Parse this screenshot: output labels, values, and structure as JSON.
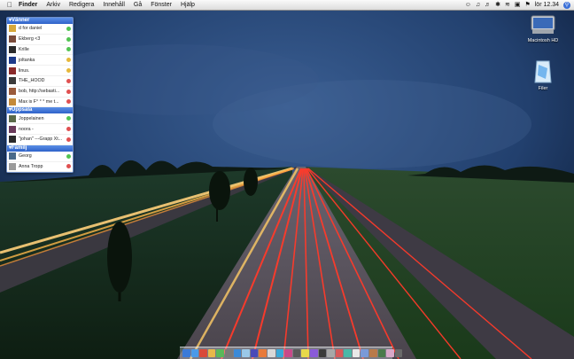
{
  "menubar": {
    "app": "Finder",
    "items": [
      "Arkiv",
      "Redigera",
      "Innehåll",
      "Gå",
      "Fönster",
      "Hjälp"
    ],
    "clock": "lör 12.34"
  },
  "buddy_list": {
    "groups": [
      {
        "name": "Vänner",
        "buddies": [
          {
            "name": "d for daniel",
            "status": "#52c452",
            "avatar": "#d7a83a"
          },
          {
            "name": "Ekberg <3",
            "status": "#52c452",
            "avatar": "#7a4b3a"
          },
          {
            "name": "Krille",
            "status": "#52c452",
            "avatar": "#2a2a2a"
          },
          {
            "name": "joltanka",
            "status": "#e6b83a",
            "avatar": "#1c3a8a"
          },
          {
            "name": "linus.",
            "status": "#e6b83a",
            "avatar": "#8a2a2a"
          },
          {
            "name": "THE_HOOD",
            "status": "#e05050",
            "avatar": "#3a3a3a"
          },
          {
            "name": "bob, http://sebasti...",
            "status": "#e05050",
            "avatar": "#9a5a3a"
          },
          {
            "name": "Max is F° ° ° me t...",
            "status": "#e05050",
            "avatar": "#c48a3a"
          }
        ]
      },
      {
        "name": "Uppsala",
        "buddies": [
          {
            "name": "Joppelainen",
            "status": "#52c452",
            "avatar": "#5a6a4a"
          },
          {
            "name": "noora -",
            "status": "#e05050",
            "avatar": "#6a3a5a"
          },
          {
            "name": "\"johan\" ---Grapp Xt...",
            "status": "#e05050",
            "avatar": "#2a2a2a"
          }
        ]
      },
      {
        "name": "Familj",
        "buddies": [
          {
            "name": "Georg",
            "status": "#52c452",
            "avatar": "#4a6a8a"
          },
          {
            "name": "Anna Tropp",
            "status": "#e05050",
            "avatar": "#9a9a9a"
          }
        ]
      }
    ]
  },
  "desktop_icons": {
    "hd": "Macintosh HD",
    "files": "Filer"
  },
  "dock": {
    "icons": [
      "#3a7ad8",
      "#4a9ae8",
      "#d84a3a",
      "#e8b84a",
      "#5ab85a",
      "#7a7a7a",
      "#3a8ad8",
      "#9ac8e8",
      "#4a4ab8",
      "#e87a3a",
      "#d8d8d8",
      "#3aa8d8",
      "#c84a8a",
      "#5a5a5a",
      "#e8d84a",
      "#8a5ad8",
      "#3a3a3a",
      "#a8a8a8",
      "#d85a5a",
      "#4ab8a8",
      "#e8e8e8",
      "#7a9ad8",
      "#b87a4a",
      "#4a7a4a",
      "#d8a8c8",
      "#6a6a6a"
    ]
  }
}
